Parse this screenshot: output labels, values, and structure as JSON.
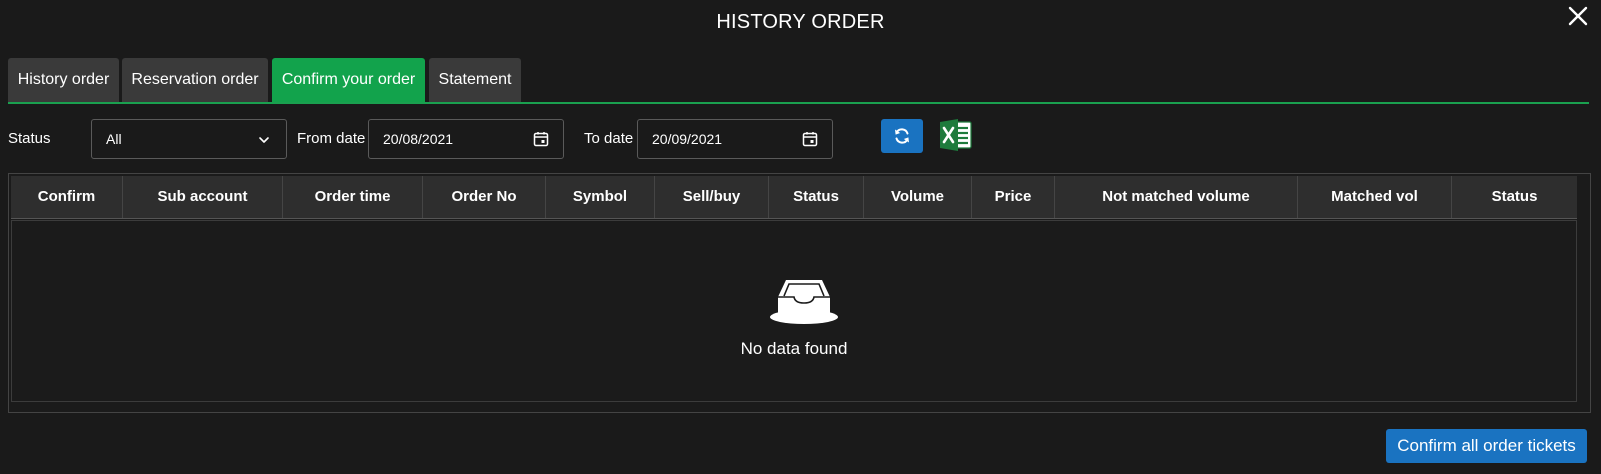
{
  "window": {
    "title": "HISTORY ORDER"
  },
  "tabs": [
    {
      "label": "History order",
      "active": false
    },
    {
      "label": "Reservation order",
      "active": false
    },
    {
      "label": "Confirm your order",
      "active": true
    },
    {
      "label": "Statement",
      "active": false
    }
  ],
  "filters": {
    "status_label": "Status",
    "status_value": "All",
    "from_label": "From date",
    "from_value": "20/08/2021",
    "to_label": "To date",
    "to_value": "20/09/2021"
  },
  "table": {
    "columns": [
      "Confirm",
      "Sub account",
      "Order time",
      "Order No",
      "Symbol",
      "Sell/buy",
      "Status",
      "Volume",
      "Price",
      "Not matched volume",
      "Matched vol",
      "Status"
    ],
    "rows": [],
    "empty_text": "No data found"
  },
  "actions": {
    "confirm_all_label": "Confirm all order tickets"
  },
  "icons": {
    "close": "close-icon",
    "dropdown": "chevron-down-icon",
    "calendar": "calendar-icon",
    "refresh": "refresh-icon",
    "excel": "excel-icon",
    "empty": "empty-inbox-icon"
  },
  "colors": {
    "background": "#1a1a1a",
    "active_tab": "#12a34c",
    "tab": "#3a3a3a",
    "primary_button": "#1a73c1",
    "accent_line": "#1aa04f",
    "excel": "#1e7b3c"
  }
}
